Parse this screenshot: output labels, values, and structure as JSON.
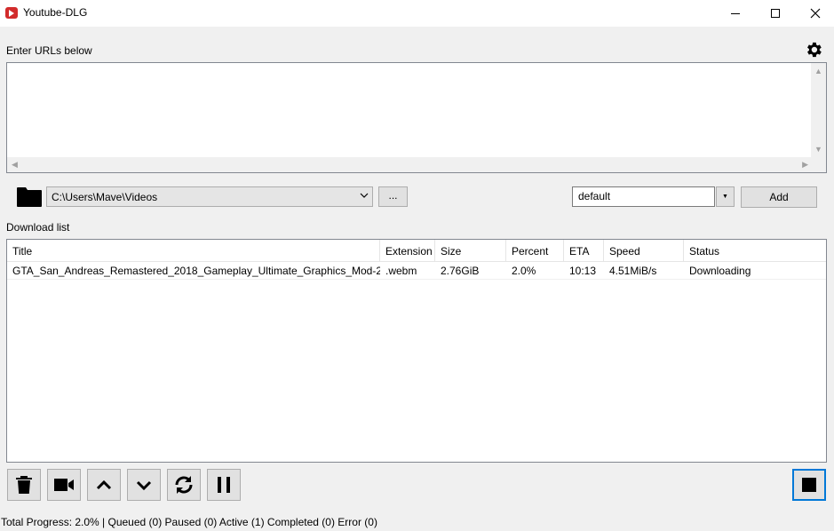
{
  "window": {
    "title": "Youtube-DLG"
  },
  "urls": {
    "label": "Enter URLs below",
    "value": ""
  },
  "path": {
    "value": "C:\\Users\\Mave\\Videos",
    "browse_label": "..."
  },
  "format": {
    "value": "default",
    "add_label": "Add"
  },
  "download_list": {
    "label": "Download list",
    "columns": [
      "Title",
      "Extension",
      "Size",
      "Percent",
      "ETA",
      "Speed",
      "Status"
    ],
    "rows": [
      {
        "title": "GTA_San_Andreas_Remastered_2018_Gameplay_Ultimate_Graphics_Mod-21...",
        "extension": ".webm",
        "size": "2.76GiB",
        "percent": "2.0%",
        "eta": "10:13",
        "speed": "4.51MiB/s",
        "status": "Downloading"
      }
    ]
  },
  "toolbar": {
    "icons": [
      "trash-icon",
      "video-camera-icon",
      "arrow-up-icon",
      "arrow-down-icon",
      "reload-icon",
      "pause-icon",
      "stop-icon"
    ]
  },
  "status_bar": {
    "text": "Total Progress: 2.0% | Queued (0) Paused (0) Active (1) Completed (0) Error (0)"
  },
  "colors": {
    "accent": "#0078d7",
    "app_icon": "#d22b2b"
  }
}
